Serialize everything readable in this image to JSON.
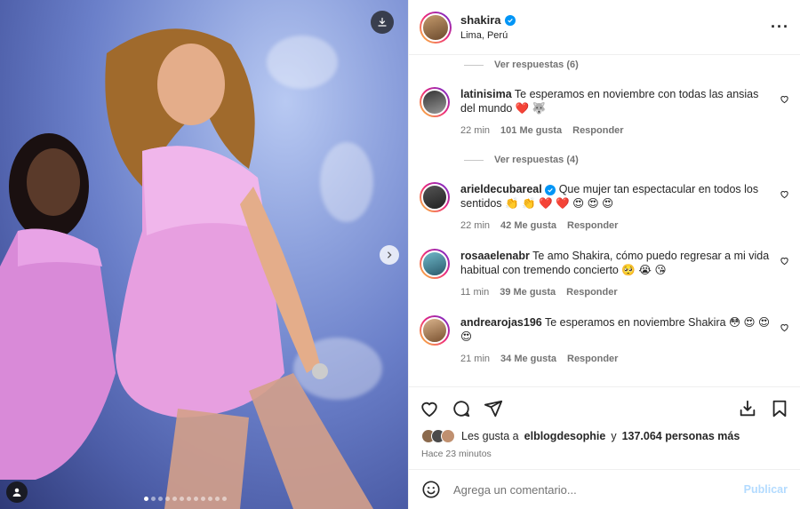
{
  "post": {
    "username": "shakira",
    "location": "Lima, Perú"
  },
  "comments": {
    "replies_top": "Ver respuestas (6)",
    "items": [
      {
        "user": "latinisima",
        "text": "Te esperamos en noviembre con todas las ansias del mundo ❤️ 🐺",
        "time": "22 min",
        "likes": "101 Me gusta",
        "reply": "Responder",
        "verified": false
      },
      {
        "user": "arieldecubareal",
        "text": "Que mujer tan espectacular en todos los sentidos 👏 👏 ❤️ ❤️ 😍 😍 😍",
        "time": "22 min",
        "likes": "42 Me gusta",
        "reply": "Responder",
        "verified": true
      },
      {
        "user": "rosaaelenabr",
        "text": "Te amo Shakira, cómo puedo regresar a mi vida habitual con tremendo concierto 🥺 😭 😘",
        "time": "11 min",
        "likes": "39 Me gusta",
        "reply": "Responder",
        "verified": false
      },
      {
        "user": "andrearojas196",
        "text": "Te esperamos en noviembre Shakira 😳 😍 😍 😍",
        "time": "21 min",
        "likes": "34 Me gusta",
        "reply": "Responder",
        "verified": false
      }
    ],
    "replies_mid": "Ver respuestas (4)"
  },
  "likes": {
    "prefix": "Les gusta a",
    "user": "elblogdesophie",
    "conj": "y",
    "count": "137.064 personas más"
  },
  "time_ago": "Hace 23 minutos",
  "add_comment": {
    "placeholder": "Agrega un comentario...",
    "publish": "Publicar"
  },
  "icons": {
    "heart": "heart-icon",
    "comment": "comment-icon",
    "share": "share-icon",
    "save": "bookmark-icon",
    "download": "download-icon",
    "more": "more-icon",
    "emoji": "emoji-icon"
  },
  "colors": {
    "accent": "#0095f6",
    "publish_disabled": "#b3dbff"
  }
}
